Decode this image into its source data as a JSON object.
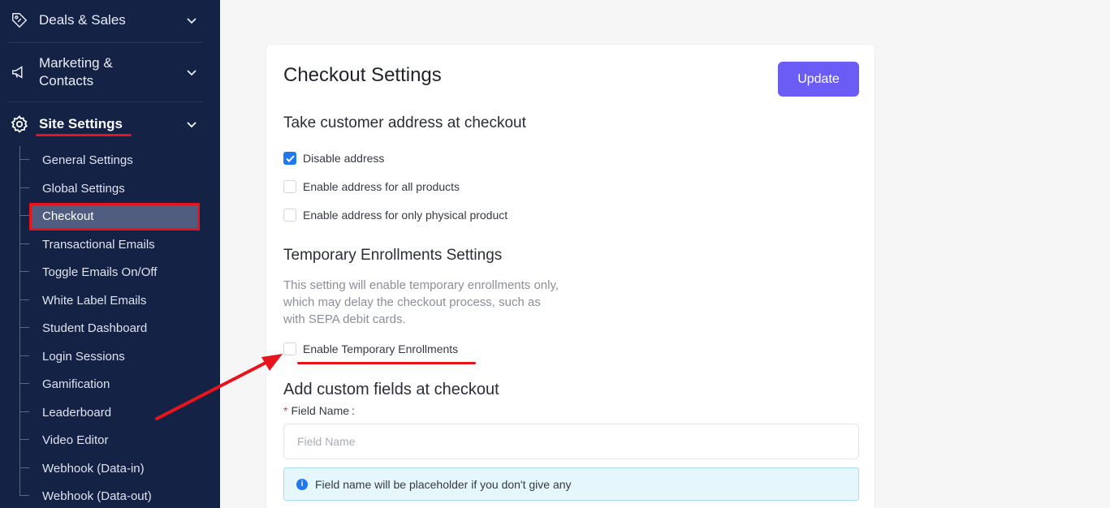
{
  "sidebar": {
    "sections": [
      {
        "label": "Deals & Sales",
        "icon": "tag-icon"
      },
      {
        "label_line1": "Marketing &",
        "label_line2": "Contacts",
        "icon": "megaphone-icon"
      },
      {
        "label": "Site Settings",
        "icon": "gear-icon"
      }
    ],
    "items": [
      {
        "label": "General Settings"
      },
      {
        "label": "Global Settings"
      },
      {
        "label": "Checkout"
      },
      {
        "label": "Transactional Emails"
      },
      {
        "label": "Toggle Emails On/Off"
      },
      {
        "label": "White Label Emails"
      },
      {
        "label": "Student Dashboard"
      },
      {
        "label": "Login Sessions"
      },
      {
        "label": "Gamification"
      },
      {
        "label": "Leaderboard"
      },
      {
        "label": "Video Editor"
      },
      {
        "label": "Webhook (Data-in)"
      },
      {
        "label": "Webhook (Data-out)"
      }
    ]
  },
  "main": {
    "title": "Checkout Settings",
    "update_label": "Update",
    "address_heading": "Take customer address at checkout",
    "address_options": [
      {
        "label": "Disable address",
        "checked": true
      },
      {
        "label": "Enable address for all products",
        "checked": false
      },
      {
        "label": "Enable address for only physical product",
        "checked": false
      }
    ],
    "temp_heading": "Temporary Enrollments Settings",
    "temp_desc": "This setting will enable temporary enrollments only, which may delay the checkout process, such as with SEPA debit cards.",
    "temp_option": {
      "label": "Enable Temporary Enrollments",
      "checked": false
    },
    "custom_heading": "Add custom fields at checkout",
    "field_label": "Field Name",
    "field_required_mark": "*",
    "field_colon": ":",
    "field_placeholder": "Field Name",
    "info_text": "Field name will be placeholder if you don't give any"
  },
  "colors": {
    "sidebar_bg": "#132245",
    "accent": "#6b5cf6",
    "checkbox_on": "#1f78f0",
    "annotation_red": "#e8141b"
  }
}
